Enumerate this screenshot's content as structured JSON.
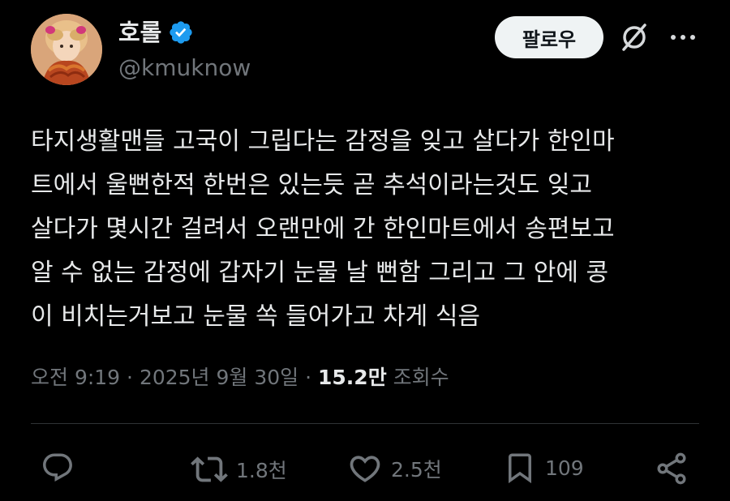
{
  "author": {
    "display_name": "호롤",
    "handle": "@kmuknow",
    "verified": true
  },
  "header": {
    "follow_label": "팔로우"
  },
  "tweet": {
    "lines": [
      "타지생활맨들 고국이 그립다는 감정을 잊고 살다가 한인마",
      "트에서 울뻔한적 한번은 있는듯 곧 추석이라는것도 잊고",
      "살다가 몇시간 걸려서 오랜만에 간 한인마트에서 송편보고",
      "알 수 없는 감정에 갑자기 눈물 날 뻔함 그리고 그 안에 콩",
      "이 비치는거보고 눈물 쏙 들어가고 차게 식음"
    ]
  },
  "meta": {
    "time": "오전 9:19",
    "sep1": " · ",
    "date": "2025년 9월 30일",
    "sep2": " · ",
    "views_count": "15.2만",
    "views_label": " 조회수"
  },
  "actions": {
    "reply": {
      "icon": "reply-icon",
      "count": ""
    },
    "retweet": {
      "icon": "retweet-icon",
      "count": "1.8천"
    },
    "like": {
      "icon": "heart-icon",
      "count": "2.5천"
    },
    "bookmark": {
      "icon": "bookmark-icon",
      "count": "109"
    },
    "share": {
      "icon": "share-icon",
      "count": ""
    }
  },
  "colors": {
    "background": "#000000",
    "text": "#e7e9ea",
    "secondary": "#71767b",
    "verified": "#1d9bf0",
    "follow_bg": "#eff3f4"
  }
}
